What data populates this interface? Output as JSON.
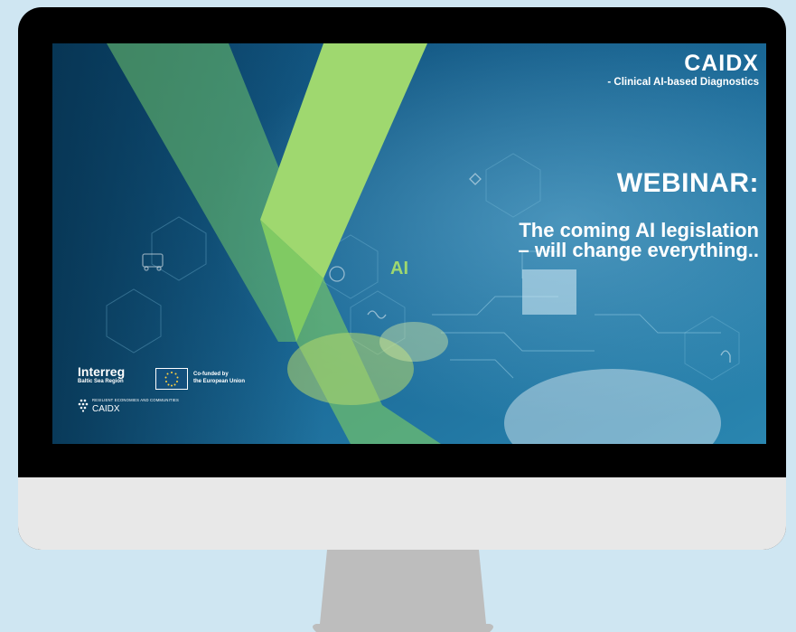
{
  "slide": {
    "brand": "CAIDX",
    "brand_subtitle": "- Clinical AI-based Diagnostics",
    "webinar": "WEBINAR:",
    "headline_line1": "The coming AI legislation",
    "headline_line2": "– will change everything..",
    "ai_tag": "AI"
  },
  "logos": {
    "interreg_name": "Interreg",
    "interreg_region": "Baltic Sea Region",
    "eu_line1": "Co-funded by",
    "eu_line2": "the European Union",
    "caidx_small": "RESILIENT ECONOMIES AND COMMUNITIES",
    "caidx_name": "CAIDX"
  },
  "colors": {
    "background": "#cfe6f2",
    "accent_green": "#9fd86f",
    "screen_blue": "#0f4f78",
    "monitor_chin": "#e8e8e8",
    "stand": "#bdbdbd"
  }
}
